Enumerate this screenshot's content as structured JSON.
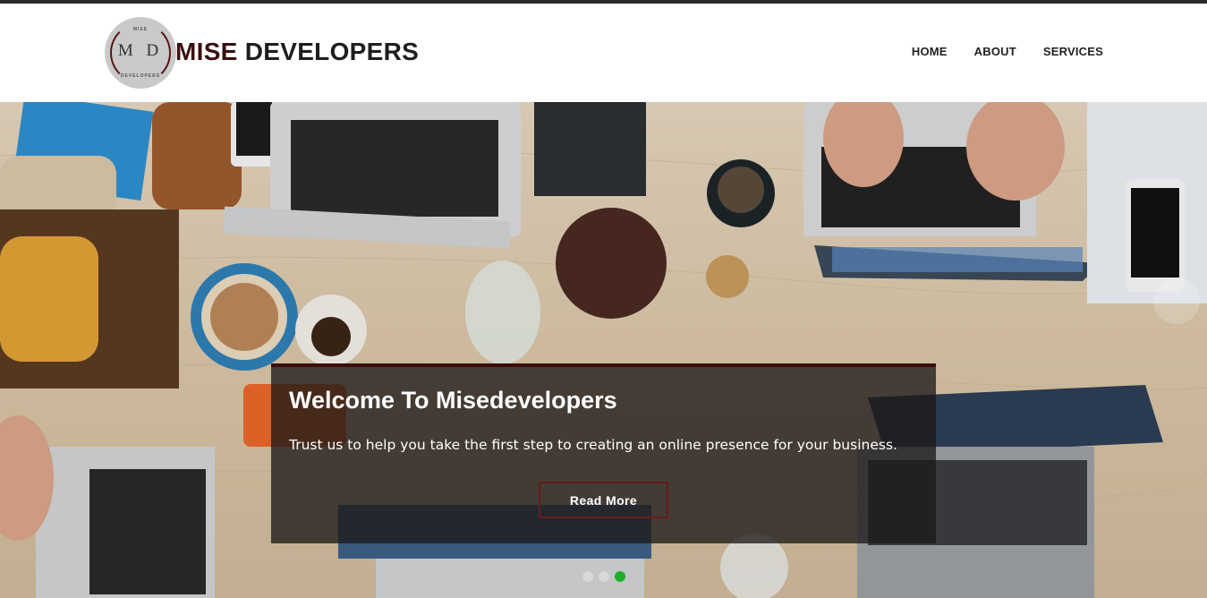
{
  "brand": {
    "logo_monogram": "M D",
    "logo_arc_top": "MISE",
    "logo_arc_bottom": "DEVELOPERS",
    "name_first": "MISE",
    "name_rest": " DEVELOPERS",
    "accent_color": "#3b1010"
  },
  "nav": {
    "items": [
      {
        "label": "HOME"
      },
      {
        "label": "ABOUT"
      },
      {
        "label": "SERVICES"
      }
    ]
  },
  "hero": {
    "title": "Welcome To Misedevelopers",
    "subtitle": "Trust us to help you take the first step to creating an online presence for your business.",
    "button_label": "Read More",
    "slides_count": 3,
    "active_slide": 3,
    "active_dot_color": "#1fae2a",
    "button_border_color": "#6b1a1a"
  }
}
